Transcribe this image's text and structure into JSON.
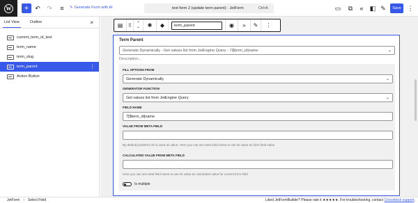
{
  "topbar": {
    "jetform_link": "Generate Form with AI",
    "doc_title": "test form 2 (update term parent) · JetForm",
    "shortcut": "Ctrl+K",
    "save_label": "Save"
  },
  "left_panel": {
    "tabs": [
      "List View",
      "Outline"
    ],
    "items": [
      {
        "label": "current_term_id_test"
      },
      {
        "label": "term_name"
      },
      {
        "label": "term_slug"
      },
      {
        "label": "term_parent"
      },
      {
        "label": "Action Button"
      }
    ]
  },
  "toolbar": {
    "field_name_value": "term_parent"
  },
  "block": {
    "title": "Term Parent",
    "main_select_value": "Generate Dynamically - Get values list from JetEngine Query - 7|$term_id|name",
    "description_placeholder": "Description...",
    "fill_options_label": "FILL OPTIONS FROM",
    "fill_options_value": "Generate Dynamically",
    "generator_label": "GENERATOR FUNCTION",
    "generator_value": "Get values list from JetEngine Query",
    "field_name_label": "FIELD NAME",
    "field_name_value": "7|$term_id|name",
    "meta_field_label": "VALUE FROM META FIELD",
    "meta_field_value": "",
    "meta_field_help": "By default post/term ID is used as value. Here you can set meta field name to use its value as form field value",
    "calc_label": "CALCULATED VALUE FROM META FIELD",
    "calc_value": "",
    "calc_help": "Here you can set meta field name to use its value as calculated value for current form field",
    "multiple_label": "Is multiple"
  },
  "statusbar": {
    "crumb_root": "JetForm",
    "crumb_sep": "›",
    "crumb_current": "Select Field",
    "note_prefix": "Liked JetFormBuilder? Please rate it ★★★★★. For troubleshooting, contact ",
    "note_link": "Crocoblock support",
    "note_suffix": "."
  }
}
